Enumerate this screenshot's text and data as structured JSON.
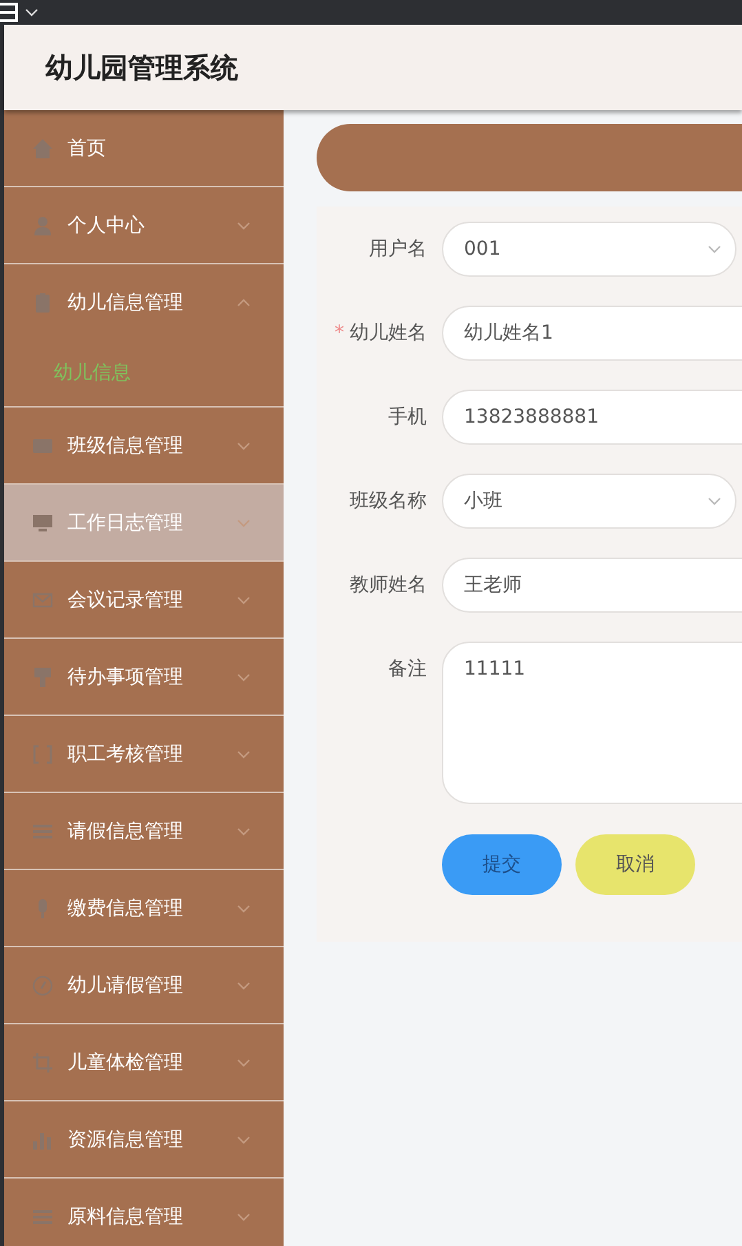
{
  "app": {
    "title": "幼儿园管理系统"
  },
  "sidebar": {
    "items": [
      {
        "label": "首页",
        "kind": "link",
        "hovered": false
      },
      {
        "label": "个人中心",
        "kind": "menu",
        "expanded": false,
        "hovered": false
      },
      {
        "label": "幼儿信息管理",
        "kind": "menu",
        "expanded": true,
        "hovered": false,
        "children": [
          {
            "label": "幼儿信息",
            "selected": true
          }
        ]
      },
      {
        "label": "班级信息管理",
        "kind": "menu",
        "expanded": false,
        "hovered": false
      },
      {
        "label": "工作日志管理",
        "kind": "menu",
        "expanded": false,
        "hovered": true
      },
      {
        "label": "会议记录管理",
        "kind": "menu",
        "expanded": false,
        "hovered": false
      },
      {
        "label": "待办事项管理",
        "kind": "menu",
        "expanded": false,
        "hovered": false
      },
      {
        "label": "职工考核管理",
        "kind": "menu",
        "expanded": false,
        "hovered": false
      },
      {
        "label": "请假信息管理",
        "kind": "menu",
        "expanded": false,
        "hovered": false
      },
      {
        "label": "缴费信息管理",
        "kind": "menu",
        "expanded": false,
        "hovered": false
      },
      {
        "label": "幼儿请假管理",
        "kind": "menu",
        "expanded": false,
        "hovered": false
      },
      {
        "label": "儿童体检管理",
        "kind": "menu",
        "expanded": false,
        "hovered": false
      },
      {
        "label": "资源信息管理",
        "kind": "menu",
        "expanded": false,
        "hovered": false
      },
      {
        "label": "原料信息管理",
        "kind": "menu",
        "expanded": false,
        "hovered": false
      }
    ]
  },
  "form": {
    "fields": [
      {
        "label": "用户名",
        "kind": "select",
        "value": "001"
      },
      {
        "label": "幼儿姓名",
        "kind": "input",
        "value": "幼儿姓名1",
        "required_mark": "*"
      },
      {
        "label": "手机",
        "kind": "input",
        "value": "13823888881"
      },
      {
        "label": "班级名称",
        "kind": "select",
        "value": "小班"
      },
      {
        "label": "教师姓名",
        "kind": "input",
        "value": "王老师"
      },
      {
        "label": "备注",
        "kind": "textarea",
        "value": "11111"
      }
    ],
    "buttons": [
      {
        "label": "提交",
        "kind": "submit"
      },
      {
        "label": "取消",
        "kind": "cancel"
      }
    ]
  }
}
